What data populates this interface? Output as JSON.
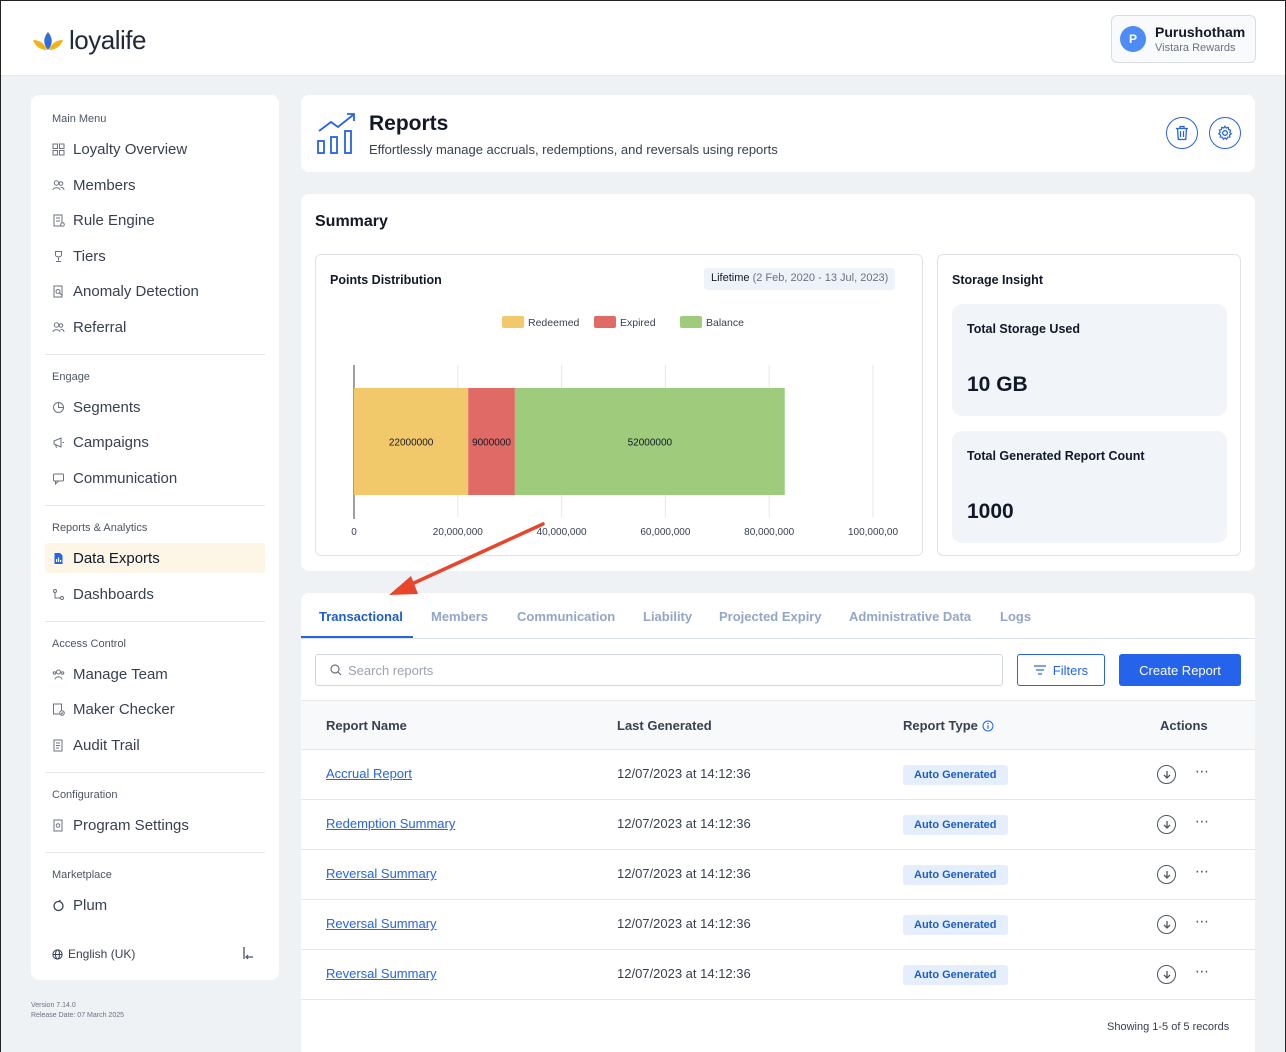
{
  "brand": {
    "name": "loyalife"
  },
  "user": {
    "initial": "P",
    "name": "Purushotham",
    "org": "Vistara Rewards"
  },
  "sidebar": {
    "sections": [
      {
        "title": "Main Menu",
        "items": [
          "Loyalty Overview",
          "Members",
          "Rule Engine",
          "Tiers",
          "Anomaly Detection",
          "Referral"
        ]
      },
      {
        "title": "Engage",
        "items": [
          "Segments",
          "Campaigns",
          "Communication"
        ]
      },
      {
        "title": "Reports & Analytics",
        "items": [
          "Data Exports",
          "Dashboards"
        ]
      },
      {
        "title": "Access Control",
        "items": [
          "Manage Team",
          "Maker Checker",
          "Audit Trail"
        ]
      },
      {
        "title": "Configuration",
        "items": [
          "Program Settings"
        ]
      },
      {
        "title": "Marketplace",
        "items": [
          "Plum"
        ]
      }
    ],
    "active_item": "Data Exports",
    "language": "English (UK)"
  },
  "version": {
    "line1": "Version 7.14.0",
    "line2": "Release Date: 07 March 2025"
  },
  "header": {
    "title": "Reports",
    "subtitle": "Effortlessly manage accruals, redemptions, and reversals using reports"
  },
  "summary": {
    "title": "Summary",
    "points_title": "Points Distribution",
    "lifetime_label": "Lifetime",
    "lifetime_range": "(2 Feb, 2020 - 13 Jul, 2023)",
    "storage_title": "Storage Insight",
    "storage_used_label": "Total Storage Used",
    "storage_used_value": "10 GB",
    "report_count_label": "Total Generated Report Count",
    "report_count_value": "1000"
  },
  "chart_data": {
    "type": "bar",
    "orientation": "horizontal",
    "stacked": true,
    "categories": [
      ""
    ],
    "series": [
      {
        "name": "Redeemed",
        "values": [
          22000000
        ],
        "color": "#f2c96a"
      },
      {
        "name": "Expired",
        "values": [
          9000000
        ],
        "color": "#e06b66"
      },
      {
        "name": "Balance",
        "values": [
          52000000
        ],
        "color": "#9ecb7c"
      }
    ],
    "xlim": [
      0,
      100000000
    ],
    "xticks": [
      "0",
      "20,000,000",
      "40,000,000",
      "60,000,000",
      "80,000,000",
      "100,000,00"
    ],
    "xtick_values": [
      0,
      20000000,
      40000000,
      60000000,
      80000000,
      100000000
    ],
    "data_labels": [
      "22000000",
      "9000000",
      "52000000"
    ],
    "legend_position": "top-center",
    "grid": true
  },
  "tabs": [
    "Transactional",
    "Members",
    "Communication",
    "Liability",
    "Projected Expiry",
    "Administrative Data",
    "Logs"
  ],
  "toolbar": {
    "search_placeholder": "Search reports",
    "filters_label": "Filters",
    "create_label": "Create Report"
  },
  "table": {
    "headers": [
      "Report Name",
      "Last Generated",
      "Report Type",
      "Actions"
    ],
    "rows": [
      {
        "name": "Accrual Report",
        "date": "12/07/2023 at 14:12:36",
        "type": "Auto Generated"
      },
      {
        "name": "Redemption Summary",
        "date": "12/07/2023 at 14:12:36",
        "type": "Auto Generated"
      },
      {
        "name": "Reversal Summary",
        "date": "12/07/2023 at 14:12:36",
        "type": "Auto Generated"
      },
      {
        "name": "Reversal Summary",
        "date": "12/07/2023 at 14:12:36",
        "type": "Auto Generated"
      },
      {
        "name": "Reversal Summary",
        "date": "12/07/2023 at 14:12:36",
        "type": "Auto Generated"
      }
    ],
    "footer": "Showing 1-5 of 5 records"
  },
  "colors": {
    "accent": "#2563eb",
    "active_nav": "#fdf6e7",
    "annotation_arrow": "#e8452c"
  }
}
